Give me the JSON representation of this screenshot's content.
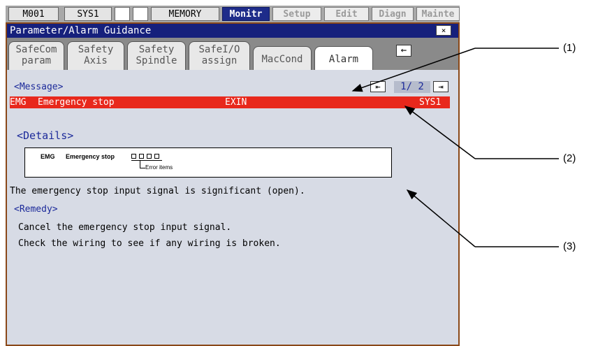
{
  "status_bar": {
    "field1": "M001",
    "field2": "SYS1",
    "field3": "",
    "field4": "",
    "field5": "MEMORY",
    "modes": [
      "Monitr",
      "Setup",
      "Edit",
      "Diagn",
      "Mainte"
    ],
    "active_mode": "Monitr"
  },
  "window": {
    "title": "Parameter/Alarm Guidance",
    "close_label": "×",
    "tabs": [
      {
        "line1": "SafeCom",
        "line2": "param"
      },
      {
        "line1": "Safety",
        "line2": "Axis"
      },
      {
        "line1": "Safety",
        "line2": "Spindle"
      },
      {
        "line1": "SafeI/O",
        "line2": "assign"
      },
      {
        "line1": "MacCond",
        "line2": ""
      },
      {
        "line1": "Alarm",
        "line2": ""
      }
    ],
    "active_tab": "Alarm",
    "tab_back_icon": "←"
  },
  "message": {
    "heading": "<Message>",
    "page_prev_icon": "⇤",
    "page_next_icon": "⇥",
    "page": "1/ 2",
    "alarm": {
      "code": "EMG",
      "text": "Emergency stop",
      "item": "EXIN",
      "system": "SYS1"
    },
    "colors": {
      "alarm_bg": "#e8281c",
      "heading_text": "#1c2a9a"
    }
  },
  "details": {
    "heading": "<Details>",
    "diagram": {
      "code": "EMG",
      "text": "Emergency stop",
      "note": "Error items"
    },
    "description": "The emergency stop input signal is significant (open)."
  },
  "remedy": {
    "heading": "<Remedy>",
    "lines": [
      "Cancel the emergency stop input signal.",
      "Check the wiring to see if any wiring is broken."
    ]
  },
  "callouts": [
    "(1)",
    "(2)",
    "(3)"
  ]
}
